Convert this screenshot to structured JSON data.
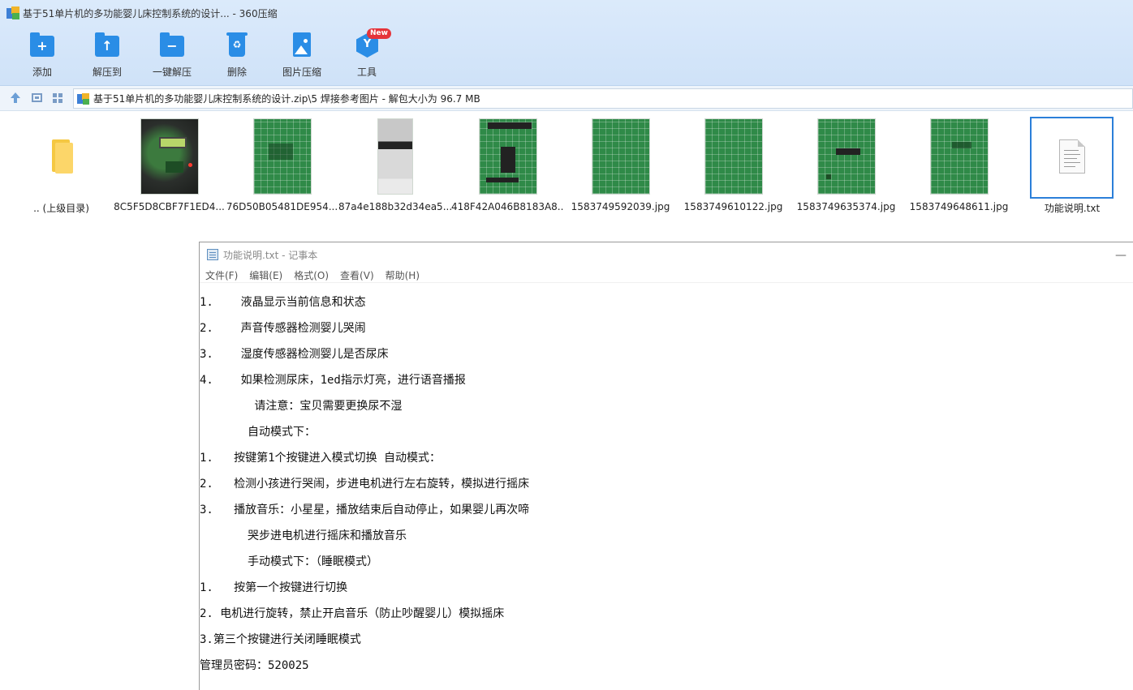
{
  "window": {
    "title": "基于51单片机的多功能婴儿床控制系统的设计... - 360压缩"
  },
  "toolbar": {
    "buttons": [
      {
        "label": "添加",
        "icon": "add-folder-icon"
      },
      {
        "label": "解压到",
        "icon": "extract-to-icon"
      },
      {
        "label": "一键解压",
        "icon": "one-click-extract-icon"
      },
      {
        "label": "删除",
        "icon": "delete-icon"
      },
      {
        "label": "图片压缩",
        "icon": "image-compress-icon"
      },
      {
        "label": "工具",
        "icon": "tools-icon",
        "badge": "New"
      }
    ]
  },
  "address_bar": {
    "path": "基于51单片机的多功能婴儿床控制系统的设计.zip\\5 焊接参考图片 - 解包大小为 96.7 MB"
  },
  "files": [
    {
      "name": ".. (上级目录)",
      "kind": "parent-folder"
    },
    {
      "name": "8C5F5D8CBF7F1ED4...",
      "kind": "photo"
    },
    {
      "name": "76D50B05481DE954...",
      "kind": "photo"
    },
    {
      "name": "87a4e188b32d34ea5...",
      "kind": "photo"
    },
    {
      "name": "418F42A046B8183A8...",
      "kind": "photo"
    },
    {
      "name": "1583749592039.jpg",
      "kind": "photo"
    },
    {
      "name": "1583749610122.jpg",
      "kind": "photo"
    },
    {
      "name": "1583749635374.jpg",
      "kind": "photo"
    },
    {
      "name": "1583749648611.jpg",
      "kind": "photo"
    },
    {
      "name": "功能说明.txt",
      "kind": "text",
      "selected": true
    }
  ],
  "notepad": {
    "title": "功能说明.txt - 记事本",
    "menu": [
      "文件(F)",
      "编辑(E)",
      "格式(O)",
      "查看(V)",
      "帮助(H)"
    ],
    "lines": [
      "1.    液晶显示当前信息和状态",
      "2.    声音传感器检测婴儿哭闹",
      "3.    湿度传感器检测婴儿是否尿床",
      "4.    如果检测尿床，1ed指示灯亮，进行语音播报",
      "        请注意：宝贝需要更换尿不湿",
      "       自动模式下：",
      "1.   按键第1个按键进入模式切换 自动模式：",
      "2.   检测小孩进行哭闹，步进电机进行左右旋转，模拟进行摇床",
      "3.   播放音乐：小星星，播放结束后自动停止，如果婴儿再次啼",
      "       哭步进电机进行摇床和播放音乐",
      "       手动模式下：（睡眠模式）",
      "1.   按第一个按键进行切换",
      "2. 电机进行旋转，禁止开启音乐（防止吵醒婴儿）模拟摇床",
      "3.第三个按键进行关闭睡眠模式",
      "管理员密码：520025"
    ]
  }
}
